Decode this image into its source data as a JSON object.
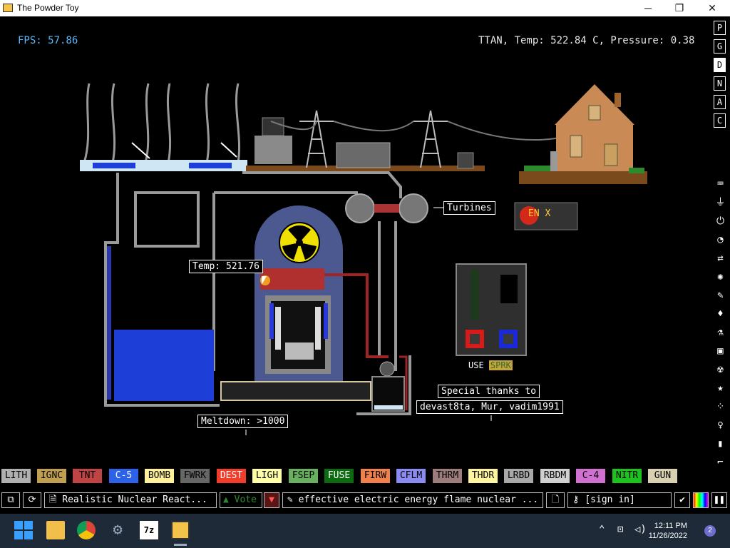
{
  "window": {
    "title": "The Powder Toy",
    "minimize": "─",
    "maximize": "❐",
    "close": "✕"
  },
  "hud": {
    "fps": "FPS: 57.86",
    "info": "TTAN, Temp: 522.84 C, Pressure: 0.38"
  },
  "scene": {
    "turbines_label": "Turbines",
    "temp_label": "Temp: 521.76",
    "meltdown_label": "Meltdown: >1000",
    "thanks_line1": "Special thanks to",
    "thanks_line2": "devast8ta, Mur, vadim1991",
    "use_text": "USE",
    "use_element": "SPRK",
    "sign_text": "EN X"
  },
  "sidebar": {
    "menu_buttons": [
      "P",
      "G",
      "D",
      "N",
      "A",
      "C"
    ],
    "active_menu": "D",
    "category_icons": [
      "keyboard-icon",
      "plug-icon",
      "power-icon",
      "gauge-icon",
      "arrows-icon",
      "atom-icon",
      "pen-icon",
      "drop-icon",
      "flask-icon",
      "square-icon",
      "radiation-icon",
      "star-icon",
      "dots-icon",
      "bulb-icon",
      "bookmark-icon",
      "brush-icon",
      "search-icon"
    ]
  },
  "elements": [
    {
      "label": "LITH",
      "bg": "#b0b0b0",
      "fg": "#000000"
    },
    {
      "label": "IGNC",
      "bg": "#c0a050",
      "fg": "#000000"
    },
    {
      "label": "TNT",
      "bg": "#c04444",
      "fg": "#000000"
    },
    {
      "label": "C-5",
      "bg": "#2c62e8",
      "fg": "#ffffff"
    },
    {
      "label": "BOMB",
      "bg": "#fff09a",
      "fg": "#000000"
    },
    {
      "label": "FWRK",
      "bg": "#666666",
      "fg": "#000000"
    },
    {
      "label": "DEST",
      "bg": "#f03c28",
      "fg": "#ffffff"
    },
    {
      "label": "LIGH",
      "bg": "#ffffa8",
      "fg": "#000000"
    },
    {
      "label": "FSEP",
      "bg": "#68b060",
      "fg": "#000000"
    },
    {
      "label": "FUSE",
      "bg": "#0c6a10",
      "fg": "#ffffff"
    },
    {
      "label": "FIRW",
      "bg": "#f0804c",
      "fg": "#000000"
    },
    {
      "label": "CFLM",
      "bg": "#8a8af0",
      "fg": "#000000"
    },
    {
      "label": "THRM",
      "bg": "#9c7c7c",
      "fg": "#000000"
    },
    {
      "label": "THDR",
      "bg": "#fff4a0",
      "fg": "#000000"
    },
    {
      "label": "LRBD",
      "bg": "#a8a8a8",
      "fg": "#000000"
    },
    {
      "label": "RBDM",
      "bg": "#d0d0d0",
      "fg": "#000000"
    },
    {
      "label": "C-4",
      "bg": "#d070d0",
      "fg": "#000000"
    },
    {
      "label": "NITR",
      "bg": "#1ec21e",
      "fg": "#000000"
    },
    {
      "label": "GUN",
      "bg": "#d8d0b0",
      "fg": "#000000"
    }
  ],
  "bottombar": {
    "save_name": "Realistic Nuclear React...",
    "vote_label": "Vote",
    "tags": "effective electric energy flame nuclear ...",
    "login": "[sign in]"
  },
  "taskbar": {
    "time": "12:11 PM",
    "date": "11/26/2022",
    "notification_count": "2"
  },
  "colors": {
    "titlebar": "#ffffff",
    "canvas": "#000000",
    "taskbar": "#1f2a38",
    "fps": "#5cb8ff",
    "vote": "#2e8a2e",
    "water": "#1e3ed8"
  }
}
